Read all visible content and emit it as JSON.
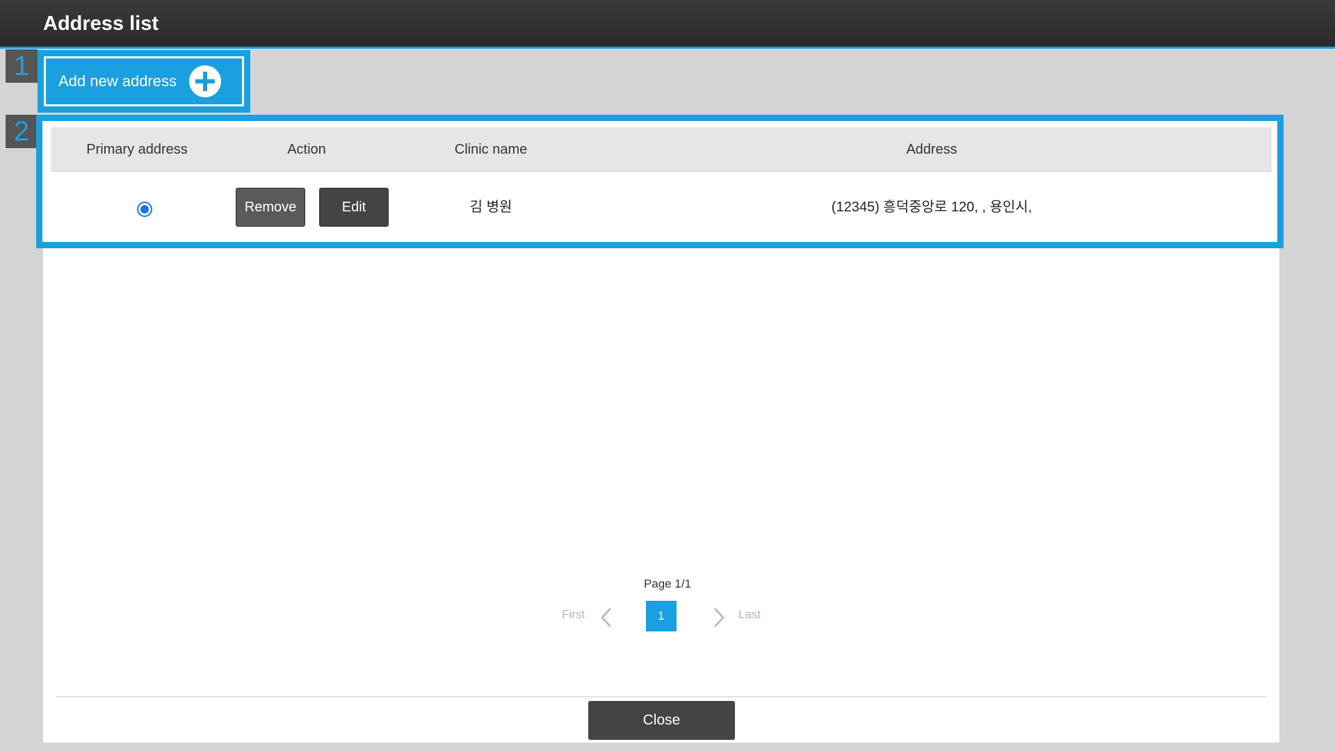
{
  "window": {
    "title": "Address list"
  },
  "markers": {
    "one": "1",
    "two": "2"
  },
  "toolbar": {
    "add_label": "Add new address"
  },
  "table": {
    "headers": {
      "primary": "Primary address",
      "action": "Action",
      "clinic": "Clinic name",
      "address": "Address"
    },
    "rows": [
      {
        "primary_selected": true,
        "remove_label": "Remove",
        "edit_label": "Edit",
        "clinic_name": "김 병원",
        "address": "(12345) 흥덕중앙로 120, , 용인시,"
      }
    ]
  },
  "pagination": {
    "page_label": "Page 1/1",
    "first": "First",
    "last": "Last",
    "current": "1"
  },
  "footer": {
    "close_label": "Close"
  },
  "colors": {
    "accent": "#1a9fe0",
    "dark_button": "#444444"
  }
}
